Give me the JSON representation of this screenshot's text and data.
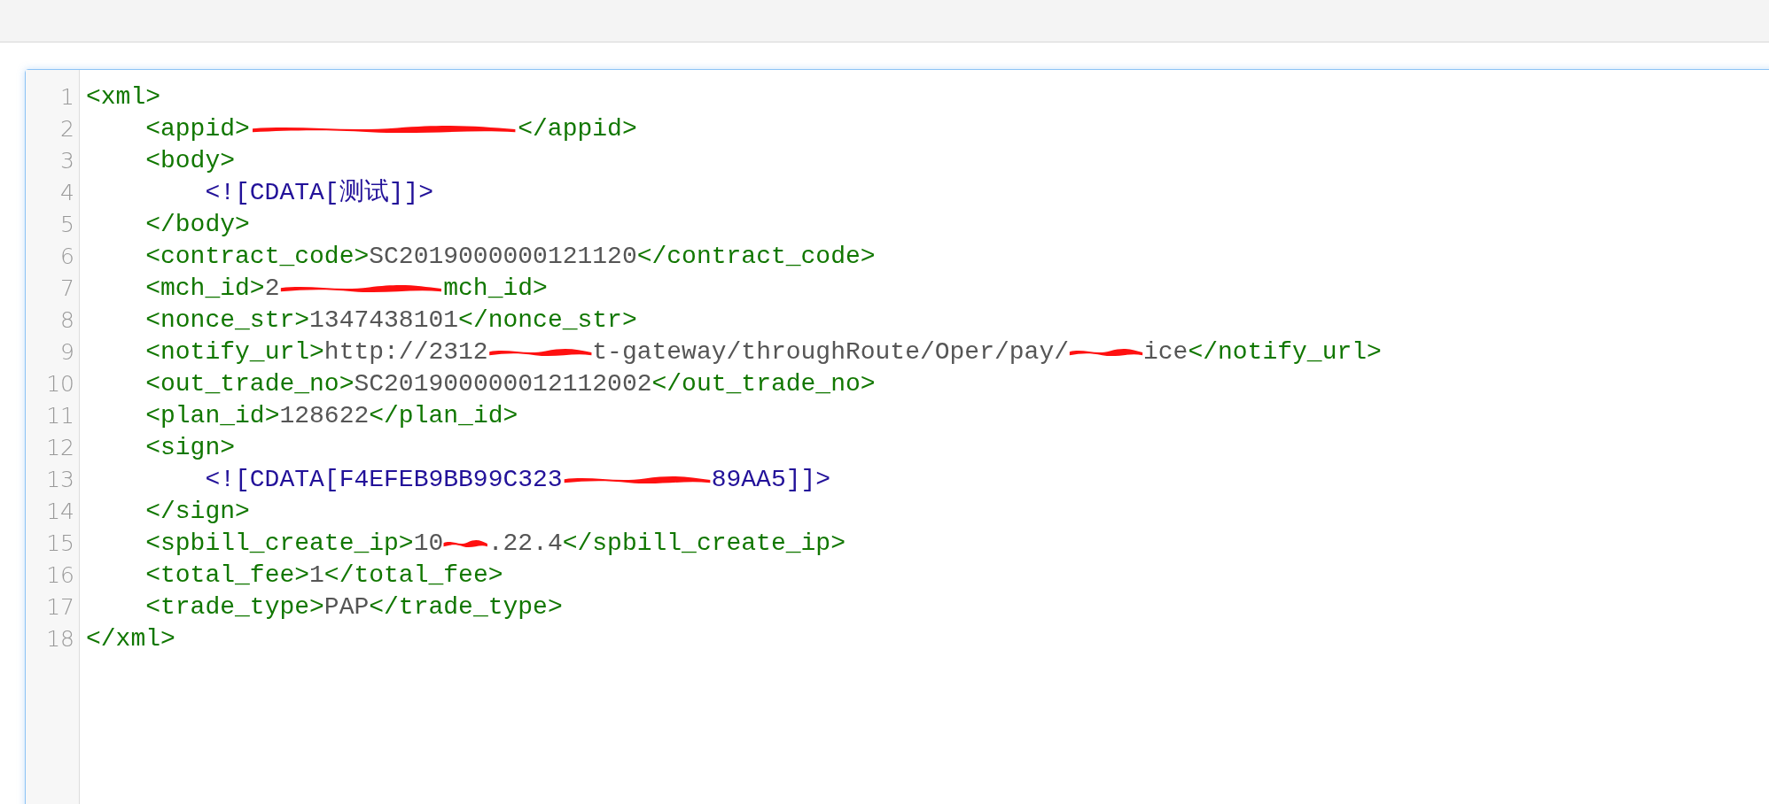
{
  "editor": {
    "lines": [
      {
        "number": "1",
        "tokens": [
          {
            "kind": "tag",
            "text": "<xml>"
          }
        ]
      },
      {
        "number": "2",
        "tokens": [
          {
            "kind": "indent"
          },
          {
            "kind": "tag",
            "text": "<appid>"
          },
          {
            "kind": "redaction"
          },
          {
            "kind": "tag",
            "text": "</appid>"
          }
        ]
      },
      {
        "number": "3",
        "tokens": [
          {
            "kind": "indent"
          },
          {
            "kind": "tag",
            "text": "<body>"
          }
        ]
      },
      {
        "number": "4",
        "tokens": [
          {
            "kind": "indent"
          },
          {
            "kind": "indent"
          },
          {
            "kind": "cdata",
            "text": "<![CDATA[测试]]>"
          }
        ]
      },
      {
        "number": "5",
        "tokens": [
          {
            "kind": "indent"
          },
          {
            "kind": "tag",
            "text": "</body>"
          }
        ]
      },
      {
        "number": "6",
        "tokens": [
          {
            "kind": "indent"
          },
          {
            "kind": "tag",
            "text": "<contract_code>"
          },
          {
            "kind": "text",
            "text": "SC2019000000121120"
          },
          {
            "kind": "tag",
            "text": "</contract_code>"
          }
        ]
      },
      {
        "number": "7",
        "tokens": [
          {
            "kind": "indent"
          },
          {
            "kind": "tag",
            "text": "<mch_id>"
          },
          {
            "kind": "text",
            "text": "2"
          },
          {
            "kind": "redaction"
          },
          {
            "kind": "tag",
            "text": "mch_id>"
          }
        ]
      },
      {
        "number": "8",
        "tokens": [
          {
            "kind": "indent"
          },
          {
            "kind": "tag",
            "text": "<nonce_str>"
          },
          {
            "kind": "text",
            "text": "1347438101"
          },
          {
            "kind": "tag",
            "text": "</nonce_str>"
          }
        ]
      },
      {
        "number": "9",
        "tokens": [
          {
            "kind": "indent"
          },
          {
            "kind": "tag",
            "text": "<notify_url>"
          },
          {
            "kind": "text",
            "text": "http://2312"
          },
          {
            "kind": "redaction"
          },
          {
            "kind": "text",
            "text": "t-gateway/throughRoute/Oper/pay/"
          },
          {
            "kind": "redaction"
          },
          {
            "kind": "text",
            "text": "ice"
          },
          {
            "kind": "tag",
            "text": "</notify_url>"
          }
        ]
      },
      {
        "number": "10",
        "tokens": [
          {
            "kind": "indent"
          },
          {
            "kind": "tag",
            "text": "<out_trade_no>"
          },
          {
            "kind": "text",
            "text": "SC201900000012112002"
          },
          {
            "kind": "tag",
            "text": "</out_trade_no>"
          }
        ]
      },
      {
        "number": "11",
        "tokens": [
          {
            "kind": "indent"
          },
          {
            "kind": "tag",
            "text": "<plan_id>"
          },
          {
            "kind": "text",
            "text": "128622"
          },
          {
            "kind": "tag",
            "text": "</plan_id>"
          }
        ]
      },
      {
        "number": "12",
        "tokens": [
          {
            "kind": "indent"
          },
          {
            "kind": "tag",
            "text": "<sign>"
          }
        ]
      },
      {
        "number": "13",
        "tokens": [
          {
            "kind": "indent"
          },
          {
            "kind": "indent"
          },
          {
            "kind": "cdata",
            "text": "<![CDATA[F4EFEB9BB99C323"
          },
          {
            "kind": "redaction"
          },
          {
            "kind": "cdata",
            "text": "89AA5]]>"
          }
        ]
      },
      {
        "number": "14",
        "tokens": [
          {
            "kind": "indent"
          },
          {
            "kind": "tag",
            "text": "</sign>"
          }
        ]
      },
      {
        "number": "15",
        "tokens": [
          {
            "kind": "indent"
          },
          {
            "kind": "tag",
            "text": "<spbill_create_ip>"
          },
          {
            "kind": "text",
            "text": "10"
          },
          {
            "kind": "redaction"
          },
          {
            "kind": "text",
            "text": ".22.4"
          },
          {
            "kind": "tag",
            "text": "</spbill_create_ip>"
          }
        ]
      },
      {
        "number": "16",
        "tokens": [
          {
            "kind": "indent"
          },
          {
            "kind": "tag",
            "text": "<total_fee>"
          },
          {
            "kind": "text",
            "text": "1"
          },
          {
            "kind": "tag",
            "text": "</total_fee>"
          }
        ]
      },
      {
        "number": "17",
        "tokens": [
          {
            "kind": "indent"
          },
          {
            "kind": "tag",
            "text": "<trade_type>"
          },
          {
            "kind": "text",
            "text": "PAP"
          },
          {
            "kind": "tag",
            "text": "</trade_type>"
          }
        ]
      },
      {
        "number": "18",
        "tokens": [
          {
            "kind": "tag",
            "text": "</xml>"
          }
        ]
      }
    ]
  }
}
